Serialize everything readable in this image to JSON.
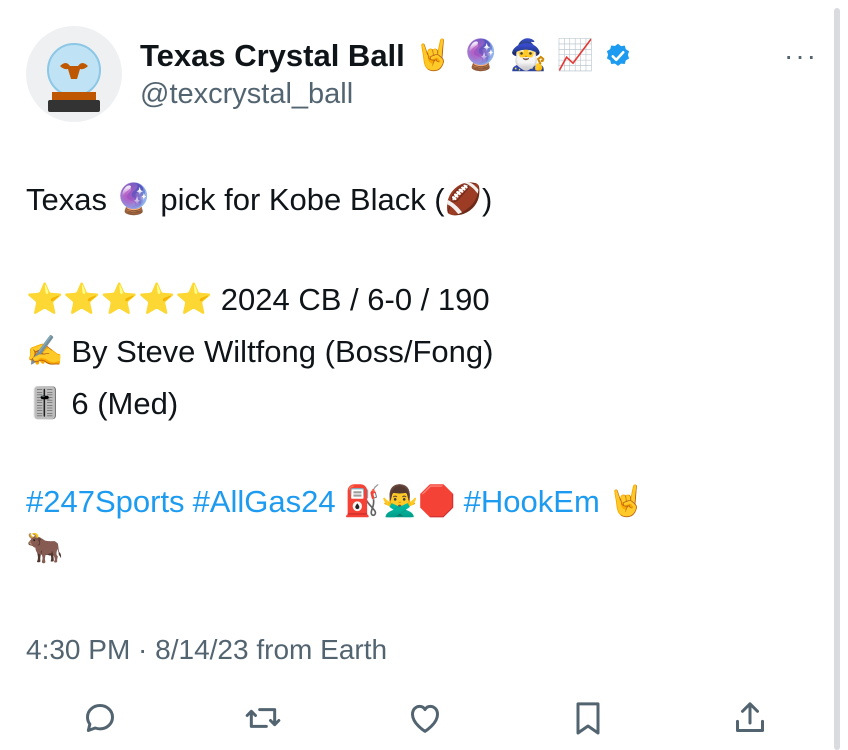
{
  "tweet": {
    "display_name": "Texas Crystal Ball",
    "name_emojis": [
      "🤘",
      "🔮",
      "🧙‍♂️",
      "📈"
    ],
    "handle": "@texcrystal_ball",
    "more_label": "···",
    "line1_prefix": "Texas",
    "line1_emoji": "🔮",
    "line1_suffix": "pick for Kobe Black (",
    "line1_football": "🏈",
    "line1_close": ")",
    "line2_stars": "⭐⭐⭐⭐⭐",
    "line2_text": "2024 CB / 6-0 / 190",
    "line3_emoji": "✍️",
    "line3_text": "By Steve Wiltfong (Boss/Fong)",
    "line4_emoji": "🎚️",
    "line4_text": "6 (Med)",
    "hashtag1": "#247Sports",
    "hashtag2": "#AllGas24",
    "hashtag_emojis": "⛽🙅‍♂️🛑",
    "hashtag3": "#HookEm",
    "hashtag_end_emoji": "🤘",
    "line6_emoji": "🐂",
    "timestamp": "4:30 PM · 8/14/23 from Earth"
  },
  "icons": [
    "reply-icon",
    "retweet-icon",
    "like-icon",
    "bookmark-icon",
    "share-icon"
  ],
  "colors": {
    "link": "#1d9bf0",
    "verified": "#1d9bf0",
    "muted": "#536471"
  }
}
